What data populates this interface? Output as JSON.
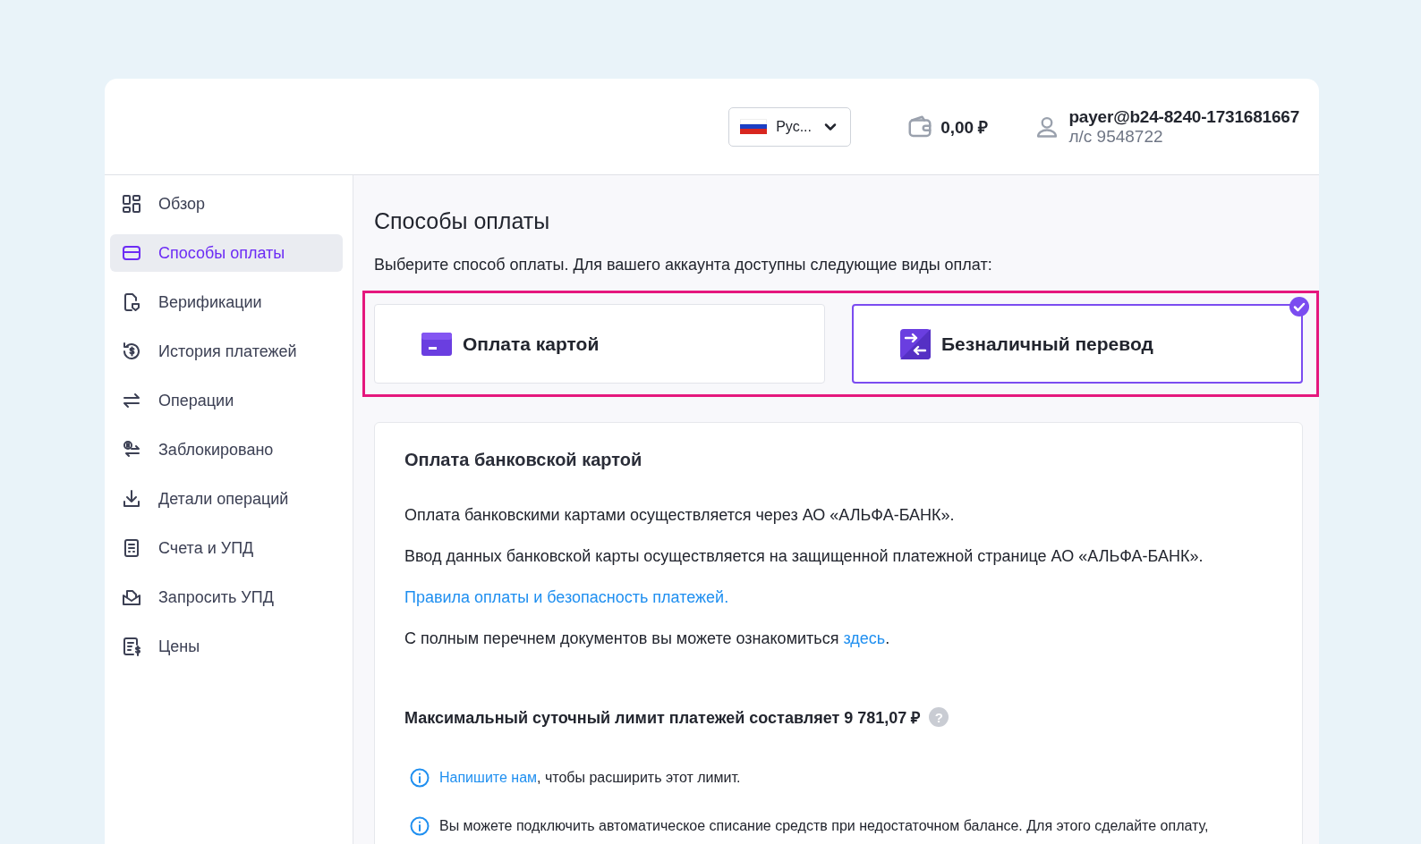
{
  "header": {
    "language": {
      "label": "Рус..."
    },
    "balance": "0,00 ₽",
    "user": {
      "email": "payer@b24-8240-1731681667",
      "account": "л/с 9548722"
    }
  },
  "sidebar": {
    "items": [
      {
        "label": "Обзор",
        "selected": false
      },
      {
        "label": "Способы оплаты",
        "selected": true
      },
      {
        "label": "Верификации",
        "selected": false
      },
      {
        "label": "История платежей",
        "selected": false
      },
      {
        "label": "Операции",
        "selected": false
      },
      {
        "label": "Заблокировано",
        "selected": false
      },
      {
        "label": "Детали операций",
        "selected": false
      },
      {
        "label": "Счета и УПД",
        "selected": false
      },
      {
        "label": "Запросить УПД",
        "selected": false
      },
      {
        "label": "Цены",
        "selected": false
      }
    ]
  },
  "page": {
    "title": "Способы оплаты",
    "subtitle": "Выберите способ оплаты. Для вашего аккаунта доступны следующие виды оплат:",
    "methods": [
      {
        "kind": "card",
        "label": "Оплата картой",
        "selected": false
      },
      {
        "kind": "transfer",
        "label": "Безналичный перевод",
        "selected": true
      }
    ],
    "info": {
      "title": "Оплата банковской картой",
      "paragraphs": [
        {
          "parts": [
            {
              "kind": "text",
              "text": "Оплата банковскими картами осуществляется через АО «АЛЬФА-БАНК»."
            }
          ]
        },
        {
          "parts": [
            {
              "kind": "text",
              "text": "Ввод данных банковской карты осуществляется на защищенной платежной странице АО «АЛЬФА-БАНК»."
            }
          ]
        },
        {
          "parts": [
            {
              "kind": "link",
              "text": "Правила оплаты и безопасность платежей."
            }
          ]
        },
        {
          "parts": [
            {
              "kind": "text",
              "text": "С полным перечнем документов вы можете ознакомиться "
            },
            {
              "kind": "link",
              "text": "здесь"
            },
            {
              "kind": "text",
              "text": "."
            }
          ]
        }
      ],
      "limit": {
        "text": "Максимальный суточный лимит платежей составляет 9 781,07 ₽",
        "help": "?"
      },
      "notes": [
        {
          "parts": [
            {
              "kind": "link",
              "text": "Напишите нам"
            },
            {
              "kind": "text",
              "text": ", чтобы расширить этот лимит."
            }
          ]
        },
        {
          "parts": [
            {
              "kind": "text",
              "text": "Вы можете подключить автоматическое списание средств при недостаточном балансе. Для этого сделайте оплату,"
            }
          ]
        }
      ]
    }
  }
}
